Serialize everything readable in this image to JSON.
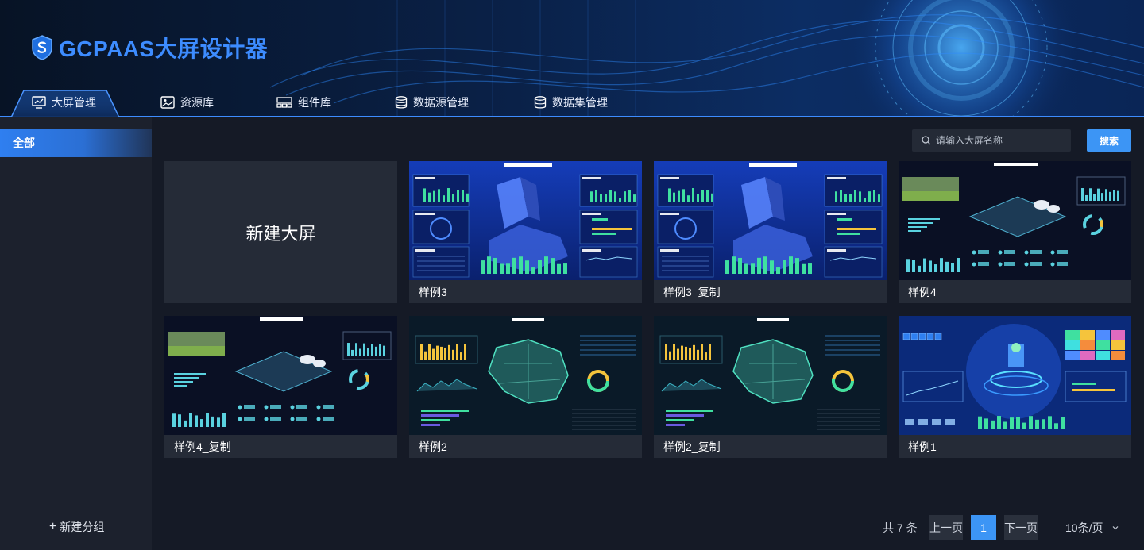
{
  "app": {
    "title": "GCPAAS大屏设计器"
  },
  "nav": [
    {
      "label": "大屏管理",
      "icon": "monitor-icon",
      "active": true
    },
    {
      "label": "资源库",
      "icon": "image-icon"
    },
    {
      "label": "组件库",
      "icon": "components-icon"
    },
    {
      "label": "数据源管理",
      "icon": "database-icon"
    },
    {
      "label": "数据集管理",
      "icon": "dataset-icon"
    }
  ],
  "sidebar": {
    "items": [
      {
        "label": "全部",
        "active": true
      }
    ],
    "add_group": "新建分组"
  },
  "search": {
    "placeholder": "请输入大屏名称",
    "value": "",
    "button": "搜索"
  },
  "new_screen": {
    "label": "新建大屏"
  },
  "cards": [
    {
      "name": "样例3",
      "theme": "city"
    },
    {
      "name": "样例3_复制",
      "theme": "city"
    },
    {
      "name": "样例4",
      "theme": "farm"
    },
    {
      "name": "样例4_复制",
      "theme": "farm"
    },
    {
      "name": "样例2",
      "theme": "map"
    },
    {
      "name": "样例2_复制",
      "theme": "map"
    },
    {
      "name": "样例1",
      "theme": "tech"
    }
  ],
  "pagination": {
    "total_text": "共 7 条",
    "prev": "上一页",
    "current": "1",
    "next": "下一页",
    "page_size": "10条/页"
  },
  "colors": {
    "accent": "#3c95f5",
    "logo": "#3d8cff",
    "background": "#151a26",
    "sidebar": "#1c212d",
    "card": "#252b37"
  }
}
